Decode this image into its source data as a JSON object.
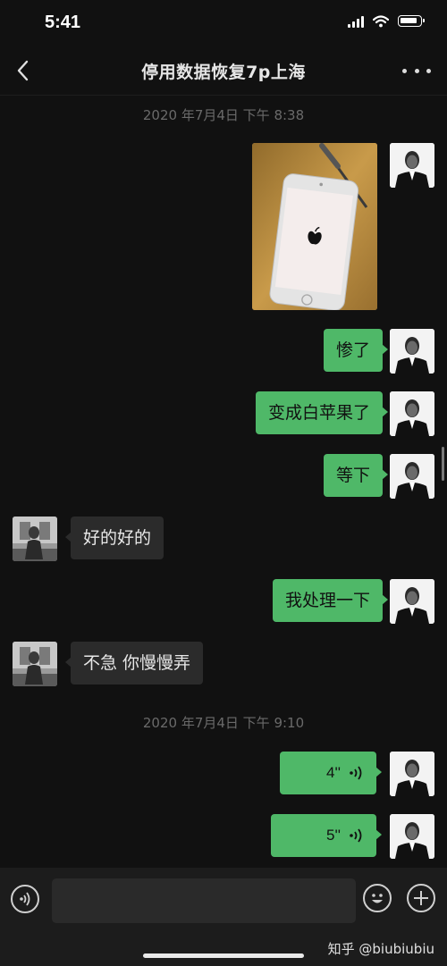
{
  "status_bar": {
    "time": "5:41"
  },
  "nav": {
    "title": "停用数据恢复7p上海"
  },
  "messages": {
    "ts1": "2020 年7月4日  下午 8:38",
    "m1": "惨了",
    "m2": "变成白苹果了",
    "m3": "等下",
    "m4": "好的好的",
    "m5": "我处理一下",
    "m6": "不急  你慢慢弄",
    "ts2": "2020 年7月4日  下午 9:10",
    "v1": "4''",
    "v2": "5''"
  },
  "watermark": "知乎 @biubiubiu",
  "icons": {
    "back": "chevron-left-icon",
    "more": "more-icon",
    "voice": "voice-icon",
    "emoji": "emoji-icon",
    "plus": "plus-icon"
  },
  "colors": {
    "self_bubble": "#4fb868",
    "other_bubble": "#2b2b2b",
    "background": "#111111"
  }
}
